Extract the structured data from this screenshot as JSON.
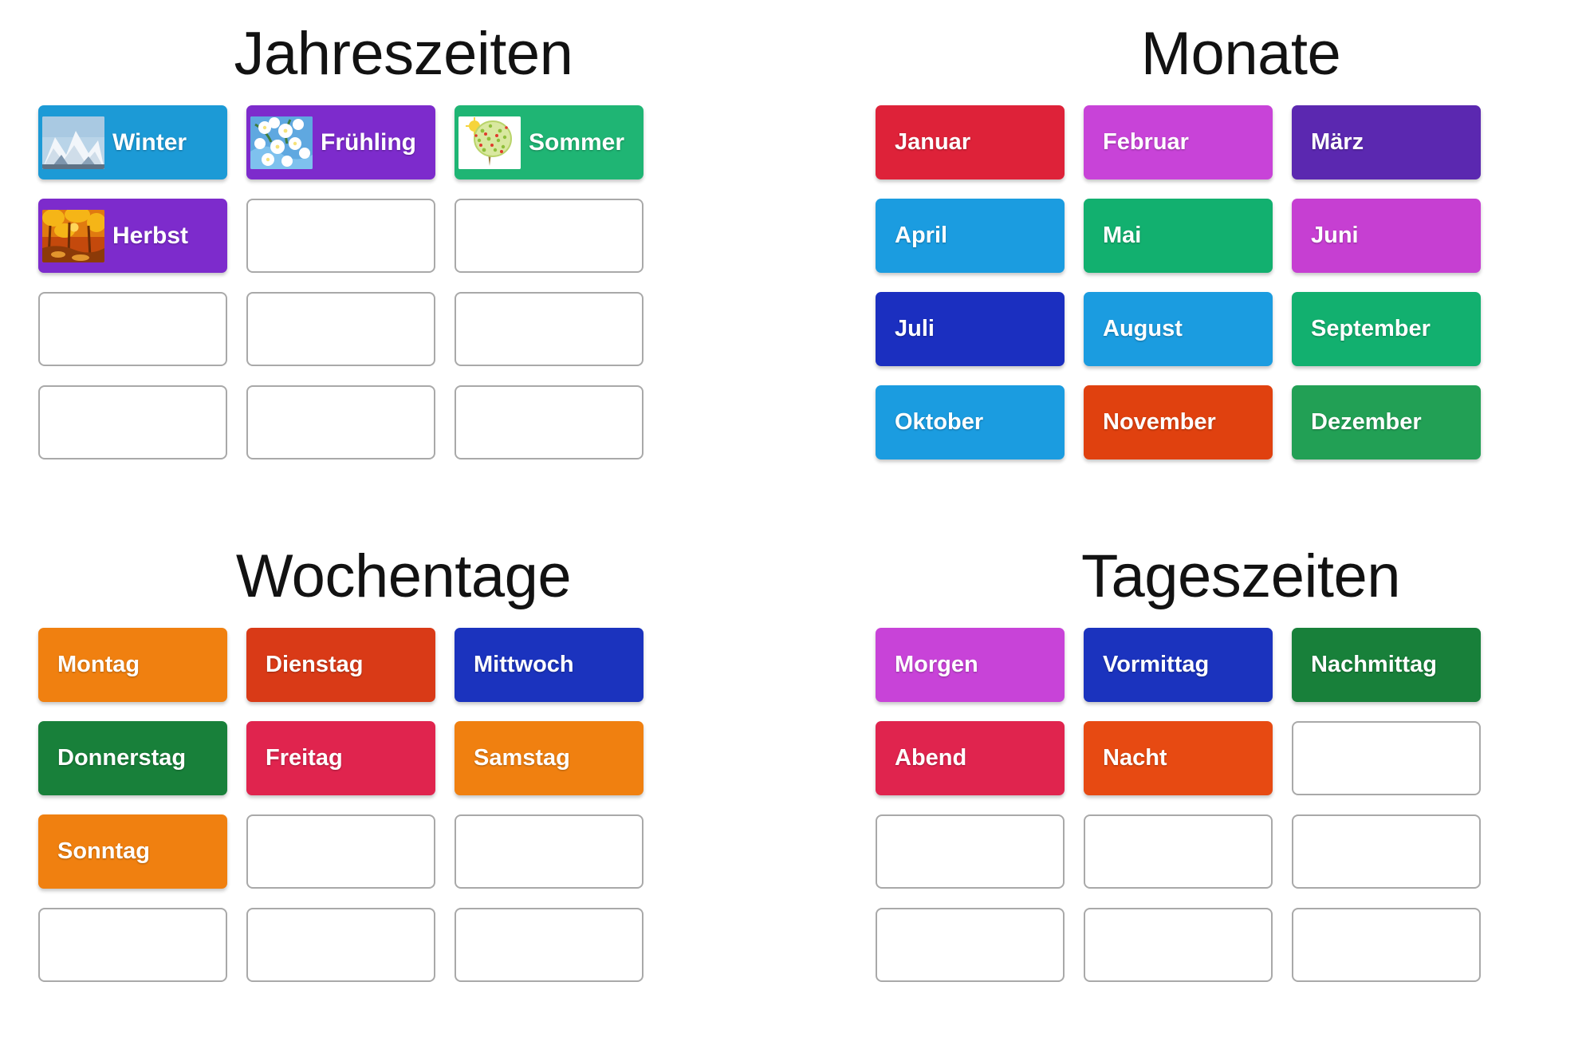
{
  "colors": {
    "blue_light": "#1C9AD6",
    "blue_bright": "#1B9CE0",
    "purple_deep": "#7D2BCC",
    "purple_dark": "#5B28B0",
    "green_emerald": "#1FB574",
    "green_sea": "#12B06F",
    "green_forest": "#18803A",
    "green_mid": "#22A055",
    "red_crimson": "#DE2239",
    "red_rose": "#E0244E",
    "red_brick": "#D93A17",
    "orange_vivid": "#F08010",
    "orange_deep": "#E74A12",
    "magenta": "#C843D8",
    "orchid": "#C63FD2",
    "blue_royal": "#1B33BE",
    "blue_navy": "#1B2FC0",
    "tile_border": "#a9a9a9",
    "text_white": "#ffffff",
    "title_black": "#121212",
    "page_bg": "#ffffff"
  },
  "panels": [
    {
      "id": "jahreszeiten",
      "title": "Jahreszeiten",
      "columns": 3,
      "tiles": [
        {
          "label": "Winter",
          "color": "#1C9AD6",
          "thumb": "winter-mountains-thumb",
          "filled": true
        },
        {
          "label": "Frühling",
          "color": "#7D2BCC",
          "thumb": "spring-blossoms-thumb",
          "filled": true
        },
        {
          "label": "Sommer",
          "color": "#1FB574",
          "thumb": "summer-tree-thumb",
          "filled": true
        },
        {
          "label": "Herbst",
          "color": "#7D2BCC",
          "thumb": "autumn-leaves-thumb",
          "filled": true
        },
        {
          "label": "",
          "filled": false
        },
        {
          "label": "",
          "filled": false
        },
        {
          "label": "",
          "filled": false
        },
        {
          "label": "",
          "filled": false
        },
        {
          "label": "",
          "filled": false
        },
        {
          "label": "",
          "filled": false
        },
        {
          "label": "",
          "filled": false
        },
        {
          "label": "",
          "filled": false
        }
      ]
    },
    {
      "id": "monate",
      "title": "Monate",
      "columns": 3,
      "tiles": [
        {
          "label": "Januar",
          "color": "#DE2239",
          "filled": true
        },
        {
          "label": "Februar",
          "color": "#C843D8",
          "filled": true
        },
        {
          "label": "März",
          "color": "#5B28B0",
          "filled": true
        },
        {
          "label": "April",
          "color": "#1B9CE0",
          "filled": true
        },
        {
          "label": "Mai",
          "color": "#12B06F",
          "filled": true
        },
        {
          "label": "Juni",
          "color": "#C63FD2",
          "filled": true
        },
        {
          "label": "Juli",
          "color": "#1B2FC0",
          "filled": true
        },
        {
          "label": "August",
          "color": "#1B9CE0",
          "filled": true
        },
        {
          "label": "September",
          "color": "#12B06F",
          "filled": true
        },
        {
          "label": "Oktober",
          "color": "#1B9CE0",
          "filled": true
        },
        {
          "label": "November",
          "color": "#E0410F",
          "filled": true
        },
        {
          "label": "Dezember",
          "color": "#22A055",
          "filled": true
        }
      ]
    },
    {
      "id": "wochentage",
      "title": "Wochentage",
      "columns": 3,
      "tiles": [
        {
          "label": "Montag",
          "color": "#F08010",
          "filled": true
        },
        {
          "label": "Dienstag",
          "color": "#D93A17",
          "filled": true
        },
        {
          "label": "Mittwoch",
          "color": "#1B33BE",
          "filled": true
        },
        {
          "label": "Donnerstag",
          "color": "#18803A",
          "filled": true
        },
        {
          "label": "Freitag",
          "color": "#E0244E",
          "filled": true
        },
        {
          "label": "Samstag",
          "color": "#F08010",
          "filled": true
        },
        {
          "label": "Sonntag",
          "color": "#F08010",
          "filled": true
        },
        {
          "label": "",
          "filled": false
        },
        {
          "label": "",
          "filled": false
        },
        {
          "label": "",
          "filled": false
        },
        {
          "label": "",
          "filled": false
        },
        {
          "label": "",
          "filled": false
        }
      ]
    },
    {
      "id": "tageszeiten",
      "title": "Tageszeiten",
      "columns": 3,
      "tiles": [
        {
          "label": "Morgen",
          "color": "#C843D8",
          "filled": true
        },
        {
          "label": "Vormittag",
          "color": "#1B33BE",
          "filled": true
        },
        {
          "label": "Nachmittag",
          "color": "#18803A",
          "filled": true
        },
        {
          "label": "Abend",
          "color": "#E0244E",
          "filled": true
        },
        {
          "label": "Nacht",
          "color": "#E74A12",
          "filled": true
        },
        {
          "label": "",
          "filled": false
        },
        {
          "label": "",
          "filled": false
        },
        {
          "label": "",
          "filled": false
        },
        {
          "label": "",
          "filled": false
        },
        {
          "label": "",
          "filled": false
        },
        {
          "label": "",
          "filled": false
        },
        {
          "label": "",
          "filled": false
        }
      ]
    }
  ]
}
